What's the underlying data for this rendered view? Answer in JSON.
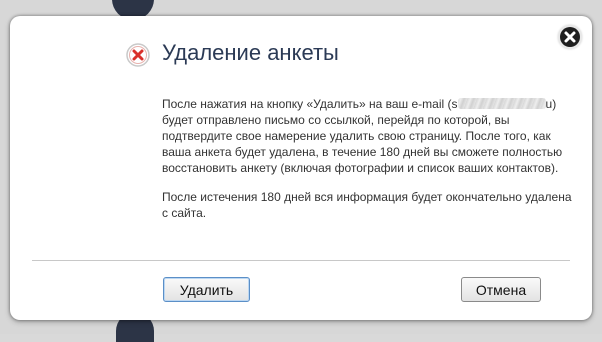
{
  "dialog": {
    "title": "Удаление анкеты",
    "paragraph1_before_email": "После нажатия на кнопку «Удалить» на ваш e-mail (s",
    "email_visible_end": "u",
    "paragraph1_after_email": ") будет отправлено письмо со ссылкой, перейдя по которой, вы подтвердите свое намерение удалить свою страницу. После того, как ваша анкета будет удалена, в течение 180 дней вы сможете полностью восстановить анкету (включая фотографии и список ваших контактов).",
    "paragraph2": "После истечения 180 дней вся информация будет окончательно удалена с сайта.",
    "delete_label": "Удалить",
    "cancel_label": "Отмена"
  },
  "icons": {
    "close": "close-icon",
    "title": "delete-icon"
  },
  "colors": {
    "title": "#2b3a55",
    "icon_red": "#d9312b",
    "primary_border": "#5b8fc7"
  }
}
